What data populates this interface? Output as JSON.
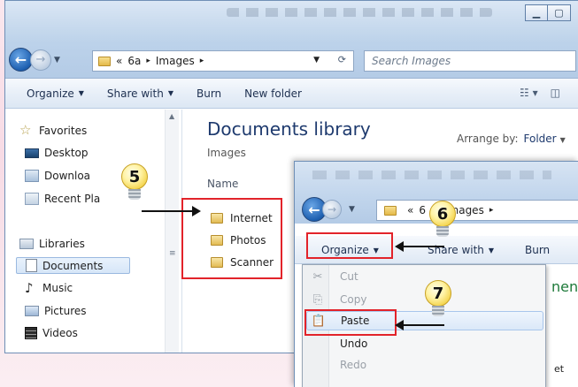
{
  "main_window": {
    "address": {
      "crumbs": [
        "«",
        "6a",
        "▸",
        "Images",
        "▸"
      ]
    },
    "search": {
      "placeholder": "Search Images"
    },
    "toolbar": {
      "organize": "Organize",
      "share_with": "Share with",
      "burn": "Burn",
      "new_folder": "New folder"
    },
    "navpane": {
      "favorites": "Favorites",
      "desktop": "Desktop",
      "downloads": "Downloa",
      "recent_places": "Recent Pla",
      "libraries": "Libraries",
      "documents": "Documents",
      "music": "Music",
      "pictures": "Pictures",
      "videos": "Videos"
    },
    "content": {
      "title": "Documents library",
      "subtitle": "Images",
      "arrange_label": "Arrange by:",
      "arrange_value": "Folder",
      "column_name": "Name",
      "folders": [
        "Internet",
        "Photos",
        "Scanner"
      ]
    }
  },
  "second_window": {
    "address": {
      "crumbs": [
        "«",
        "6",
        "Images",
        "▸"
      ]
    },
    "toolbar": {
      "organize": "Organize",
      "share_with": "Share with",
      "burn": "Burn"
    },
    "menu": {
      "cut": "Cut",
      "copy": "Copy",
      "paste": "Paste",
      "undo": "Undo",
      "redo": "Redo"
    },
    "partial_right_text": "nen",
    "partial_right_text2": "et"
  },
  "annotations": {
    "step5": "5",
    "step6": "6",
    "step7": "7",
    "highlight_color": "#e2232a"
  },
  "icons": [
    "back-arrow-icon",
    "forward-arrow-icon",
    "folder-icon",
    "star-icon",
    "desktop-icon",
    "downloads-icon",
    "recent-places-icon",
    "libraries-icon",
    "document-icon",
    "music-icon",
    "pictures-icon",
    "videos-icon",
    "cut-icon",
    "copy-icon",
    "paste-icon",
    "lightbulb-icon"
  ]
}
